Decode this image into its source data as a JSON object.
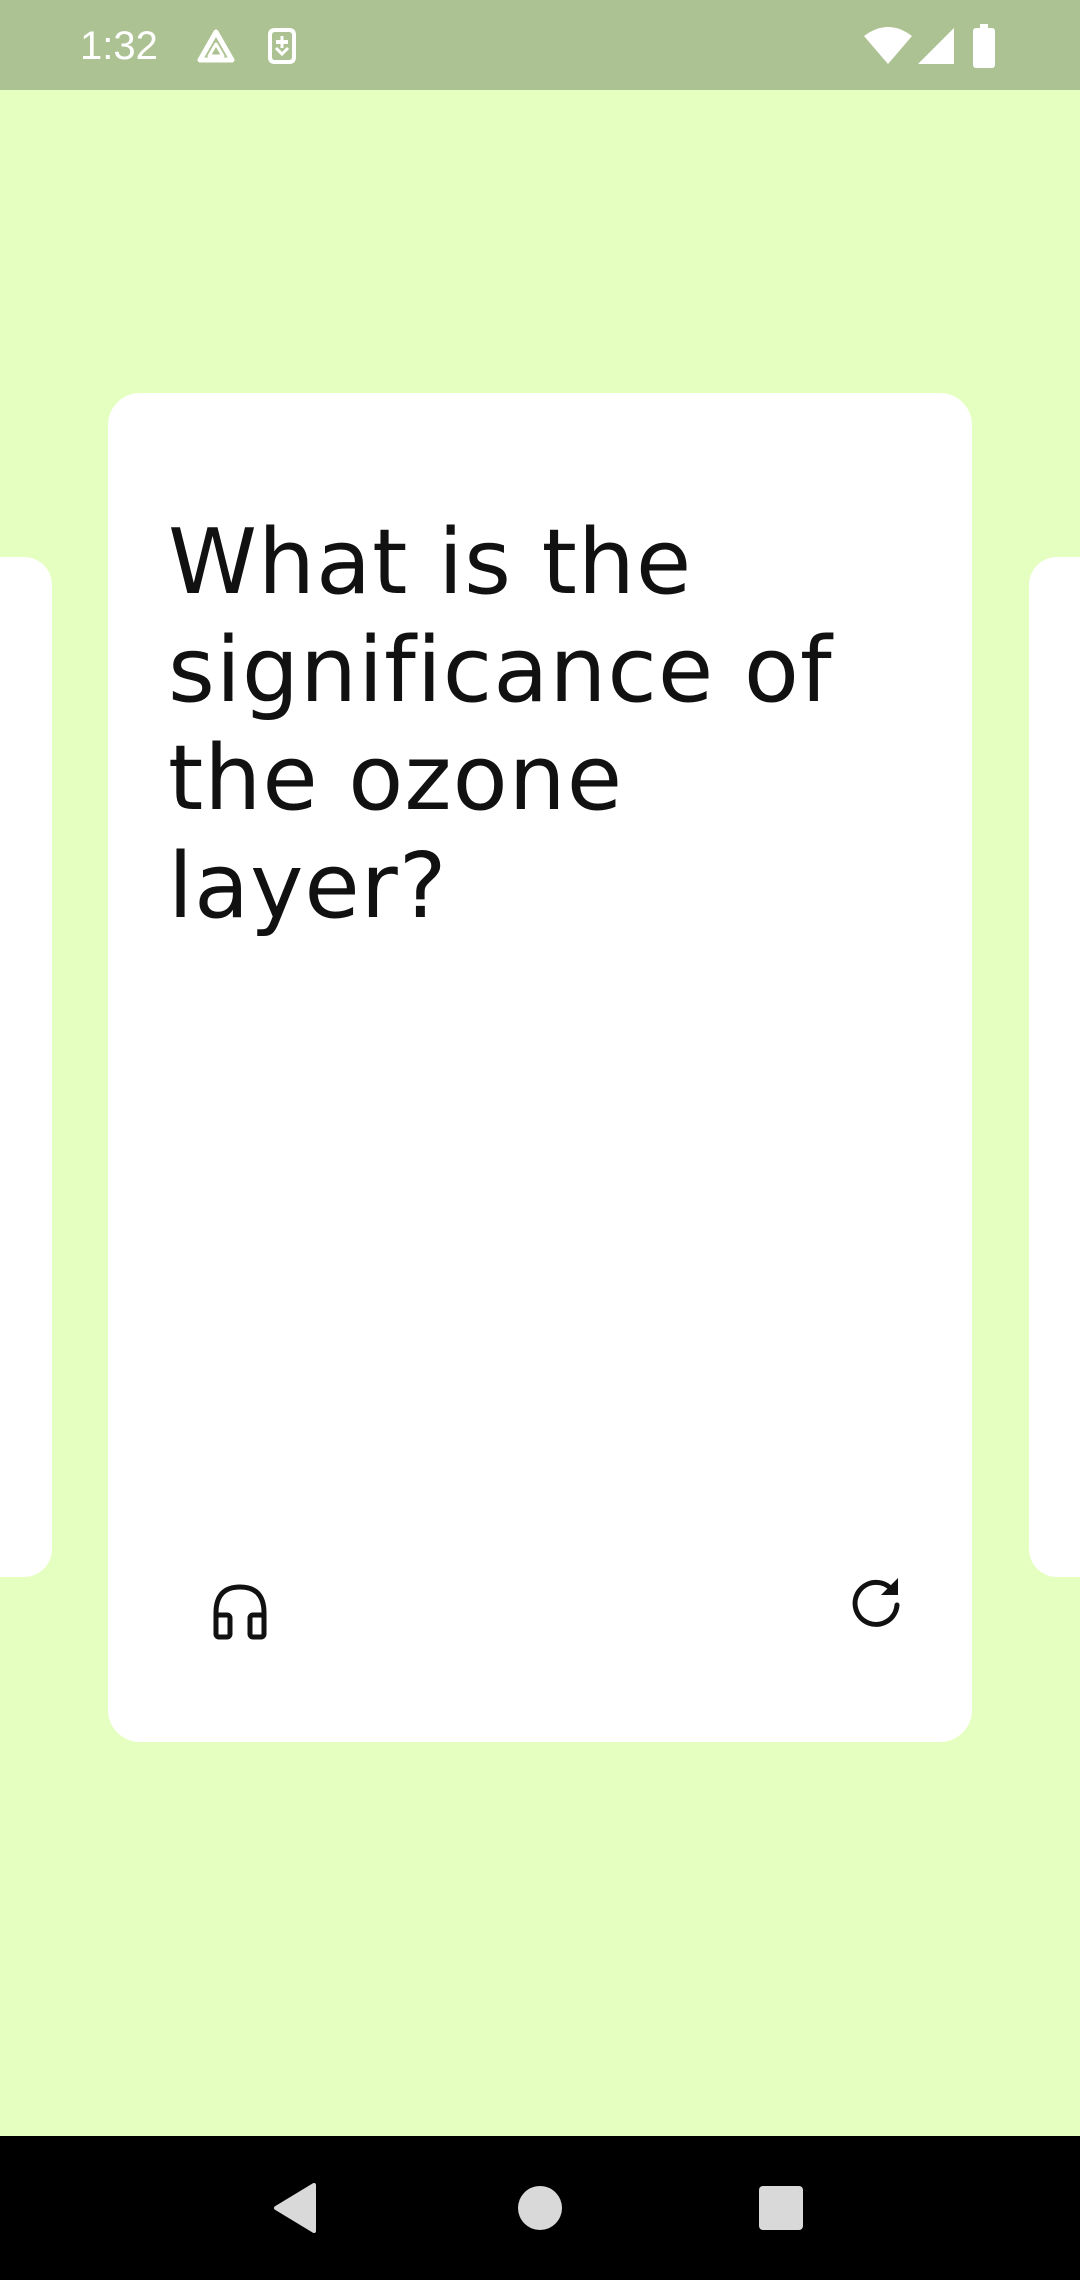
{
  "status_bar": {
    "time": "1:32",
    "notification_icons": [
      "drive-icon",
      "sim-notification-icon"
    ],
    "system_icons": [
      "wifi-icon",
      "cell-signal-icon",
      "battery-icon"
    ]
  },
  "flashcard": {
    "question": "What is the significance of the ozone layer?",
    "listen_icon": "headphones-icon",
    "flip_icon": "refresh-icon"
  },
  "nav_bar": {
    "buttons": [
      "back-icon",
      "home-icon",
      "recents-icon"
    ]
  },
  "colors": {
    "background": "#e5ffc0",
    "status_bar": "#adc293",
    "card": "#ffffff",
    "text": "#111111"
  }
}
